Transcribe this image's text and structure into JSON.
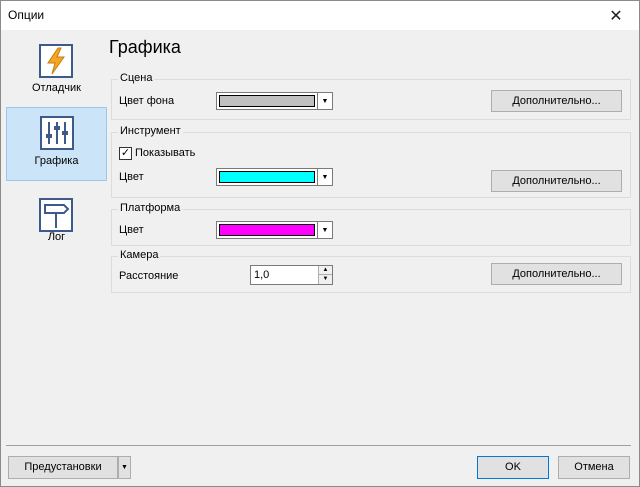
{
  "window": {
    "title": "Опции",
    "close_symbol": "✕"
  },
  "sidebar": {
    "items": [
      {
        "label": "Отладчик",
        "icon": "lightning-icon"
      },
      {
        "label": "Графика",
        "icon": "sliders-icon",
        "selected": true
      },
      {
        "label": "Лог",
        "icon": "signpost-icon"
      }
    ]
  },
  "page": {
    "title": "Графика"
  },
  "scene": {
    "title": "Сцена",
    "bg_label": "Цвет фона",
    "bg_color": "#c0c0c0",
    "advanced_label": "Дополнительно..."
  },
  "tool": {
    "title": "Инструмент",
    "show_label": "Показывать",
    "show_checked": true,
    "check_mark": "✓",
    "color_label": "Цвет",
    "color": "#00ffff",
    "advanced_label": "Дополнительно..."
  },
  "platform": {
    "title": "Платформа",
    "color_label": "Цвет",
    "color": "#ff00ff"
  },
  "camera": {
    "title": "Камера",
    "distance_label": "Расстояние",
    "distance_value": "1,0",
    "advanced_label": "Дополнительно..."
  },
  "footer": {
    "presets_label": "Предустановки",
    "ok_label": "OK",
    "cancel_label": "Отмена"
  }
}
